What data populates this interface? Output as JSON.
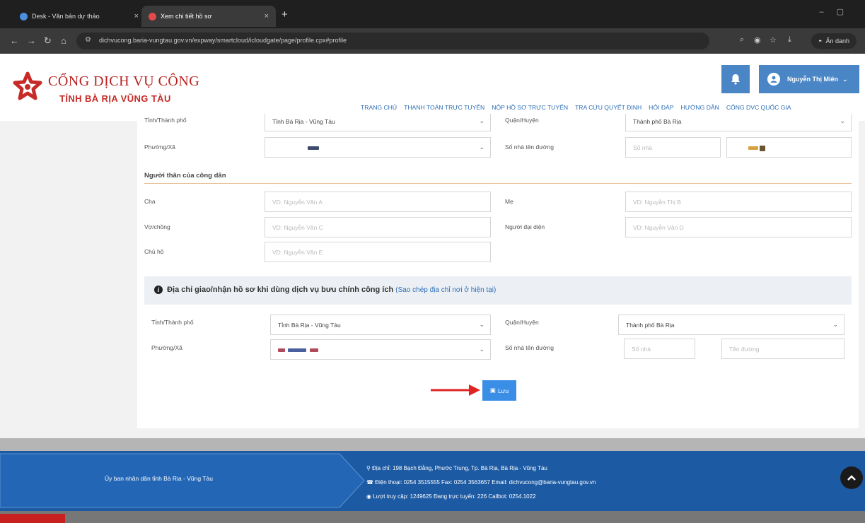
{
  "browser": {
    "tabs": [
      {
        "label": "Desk - Văn bản dự thảo",
        "close": "×",
        "favicon_color": "#4a8fe0"
      },
      {
        "label": "Xem chi tiết hồ sơ",
        "close": "×",
        "favicon_color": "#e04a4a"
      }
    ],
    "new_tab": "+",
    "url": "dichvucong.baria-vungtau.gov.vn/expway/smartcloud/icloudgate/page/profile.cpx#profile",
    "incognito_label": "Ẩn danh"
  },
  "site": {
    "brand_line1": "CỔNG DỊCH VỤ CÔNG",
    "brand_line2": "TỈNH BÀ RỊA VŨNG TÀU",
    "user_name": "Nguyễn Thị Miên",
    "nav": [
      "TRANG CHỦ",
      "THANH TOÁN TRỰC TUYẾN",
      "NỘP HỒ SƠ TRỰC TUYẾN",
      "TRA CỨU QUYẾT ĐỊNH",
      "HỎI ĐÁP",
      "HƯỚNG DẪN",
      "CỔNG DVC QUỐC GIA"
    ]
  },
  "form": {
    "top_row": {
      "province_label": "Tỉnh/Thành phố",
      "province_value": "Tỉnh Bà Rịa - Vũng Tàu",
      "district_label": "Quận/Huyện",
      "district_value": "Thành phố Bà Rịa",
      "ward_label": "Phường/Xã",
      "street_label": "Số nhà tên đường",
      "house_placeholder": "Số nhà"
    },
    "relatives": {
      "title": "Người thân của công dân",
      "father_label": "Cha",
      "father_placeholder": "VD: Nguyễn Văn A",
      "mother_label": "Mẹ",
      "mother_placeholder": "VD: Nguyễn Thị B",
      "spouse_label": "Vợ/chồng",
      "spouse_placeholder": "VD: Nguyễn Văn C",
      "rep_label": "Người đại diện",
      "rep_placeholder": "VD: Nguyễn Văn D",
      "guardian_label": "Chủ hộ",
      "guardian_placeholder": "VD: Nguyễn Văn E"
    },
    "postal": {
      "notice_text": "Địa chỉ giao/nhận hồ sơ khi dùng dịch vụ bưu chính công ích",
      "copy_link": "(Sao chép địa chỉ nơi ở hiện tại)",
      "province_label": "Tỉnh/Thành phố",
      "province_value": "Tỉnh Bà Rịa - Vũng Tàu",
      "district_label": "Quận/Huyện",
      "district_value": "Thành phố Bà Rịa",
      "ward_label": "Phường/Xã",
      "street_label": "Số nhà tên đường",
      "house_placeholder": "Số nhà",
      "street_placeholder": "Tên đường"
    },
    "save_label": "Lưu"
  },
  "footer": {
    "org": "Ủy ban nhân dân tỉnh Bà Rịa - Vũng Tàu",
    "address": "Địa chỉ: 198 Bạch Đằng, Phước Trung, Tp. Bà Rịa, Bà Rịa - Vũng Tàu",
    "contact": "Điện thoại: 0254 3515555  Fax: 0254 3563657  Email: dichvucong@baria-vungtau.gov.vn",
    "stats": "Lượt truy cập: 1249625   Đang trực tuyến: 226   Callbot: 0254.1022"
  },
  "colors": {
    "brand_red": "#b8201f",
    "accent_blue": "#4a86c5",
    "link_blue": "#2e6fb6",
    "footer_blue": "#1c5aa3",
    "save_blue": "#3b8ee6"
  }
}
